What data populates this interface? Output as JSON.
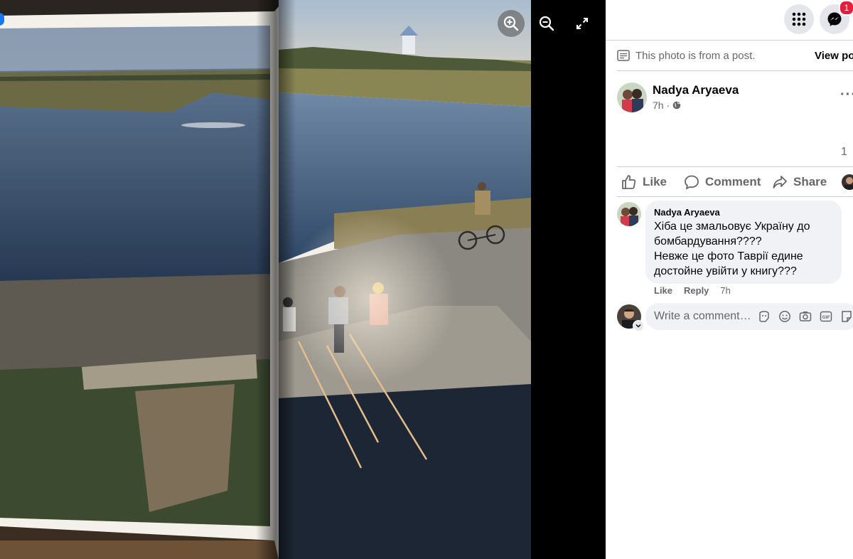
{
  "post_note": {
    "text": "This photo is from a post.",
    "view_link": "View post"
  },
  "author": {
    "name": "Nadya Aryaeva",
    "time": "7h",
    "audience_icon": "globe-icon"
  },
  "post_more_icon": "more-horizontal-icon",
  "reaction_count": "1",
  "actions": {
    "like": "Like",
    "comment": "Comment",
    "share": "Share"
  },
  "comment": {
    "author": "Nadya Aryaeva",
    "lines": [
      "Хіба це змальовує Україну до",
      "бомбардування????",
      "Невже це фото Таврії едине",
      "достойне увійти у книгу???"
    ],
    "like_label": "Like",
    "reply_label": "Reply",
    "time": "7h"
  },
  "composer": {
    "placeholder": "Write a comment…"
  },
  "header": {
    "notification_count": "1",
    "menu_icon": "grid-menu-icon",
    "messenger_icon": "messenger-icon"
  },
  "viewer": {
    "zoom_in_icon": "zoom-in-icon",
    "zoom_out_icon": "zoom-out-icon",
    "fullscreen_icon": "fullscreen-icon"
  },
  "colors": {
    "brand_blue": "#1877f2",
    "text_primary": "#050505",
    "text_secondary": "#65676b",
    "bubble_bg": "#f0f2f5",
    "badge_red": "#e41e3f"
  }
}
